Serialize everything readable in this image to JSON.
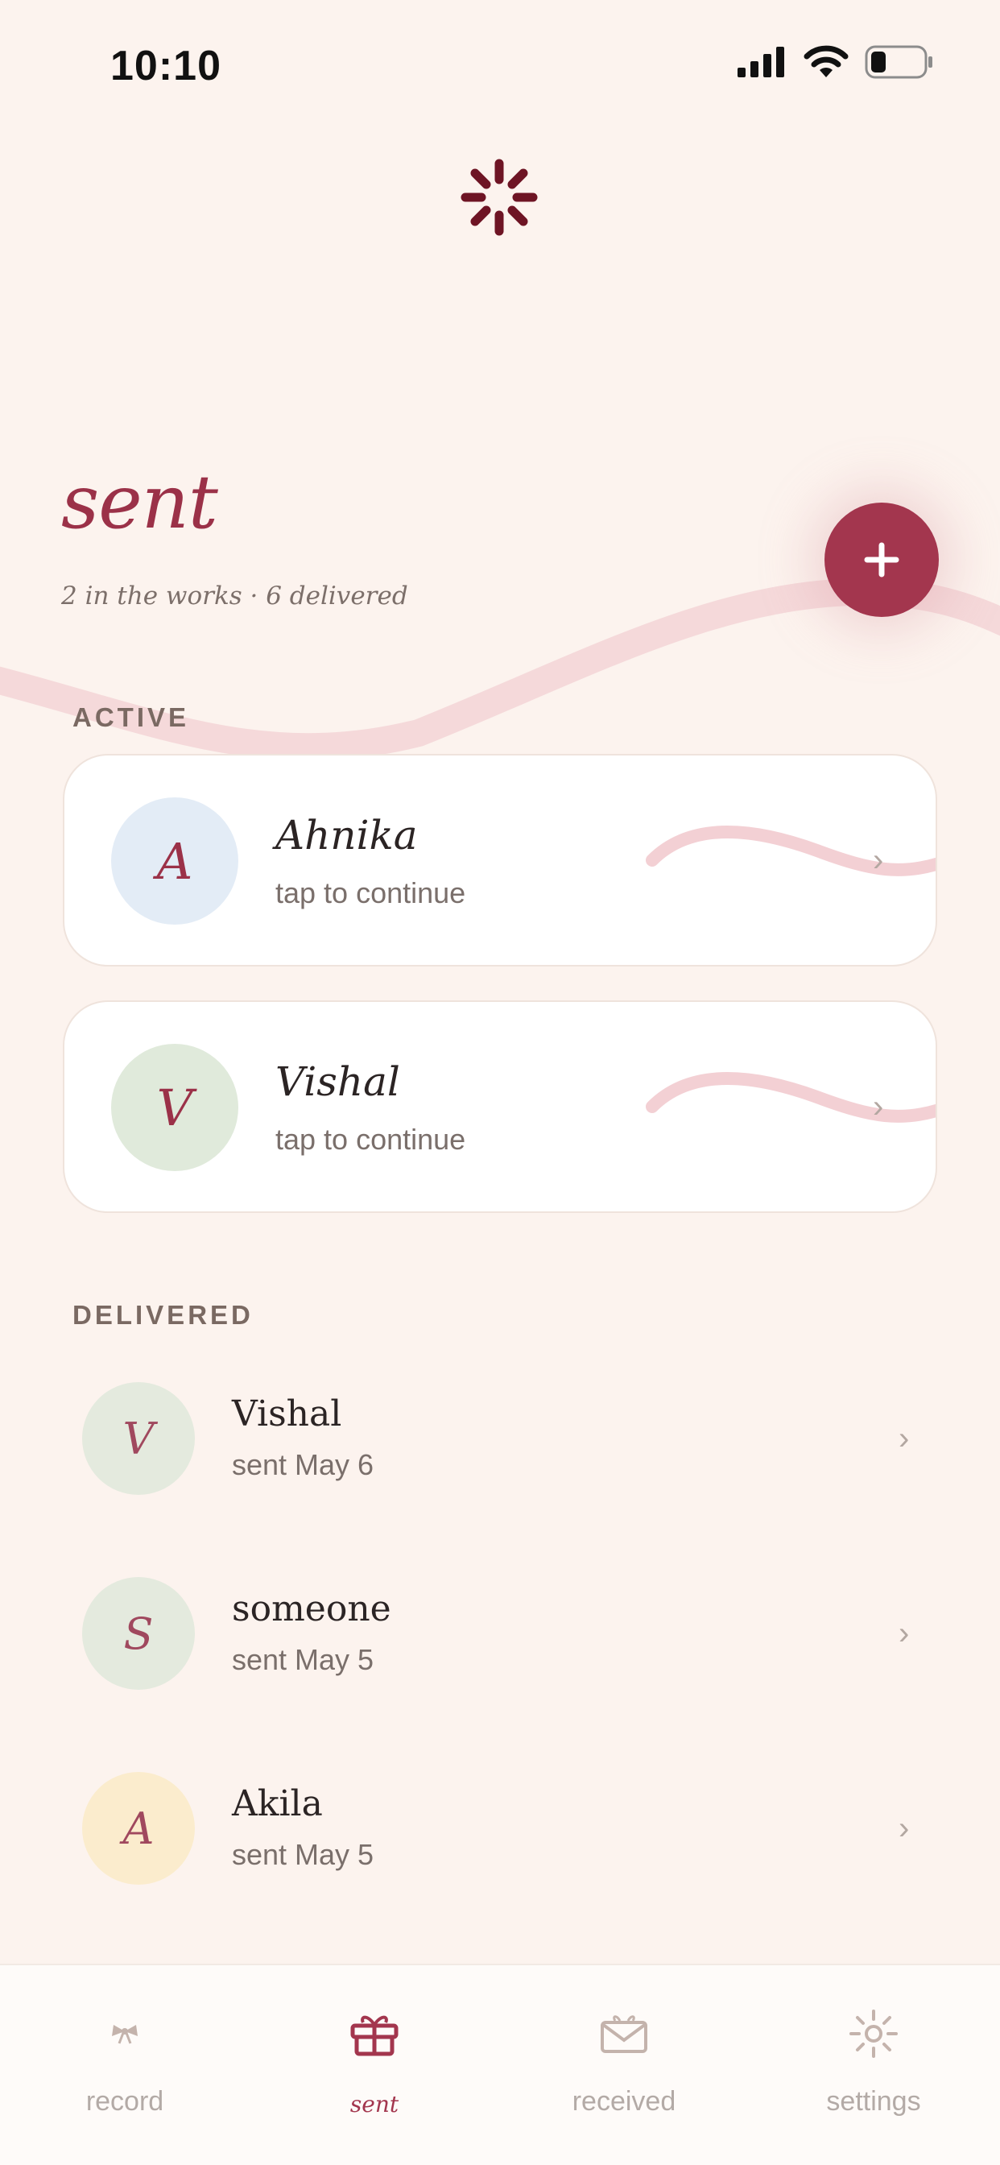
{
  "status": {
    "time": "10:10"
  },
  "header": {
    "title": "sent",
    "subtitle": "2 in the works · 6 delivered",
    "add_button": "+"
  },
  "active": {
    "label": "ACTIVE",
    "items": [
      {
        "initial": "A",
        "name": "Ahnika",
        "hint": "tap to continue",
        "avatar_color": "#e3ecf6"
      },
      {
        "initial": "V",
        "name": "Vishal",
        "hint": "tap to continue",
        "avatar_color": "#e0eadb"
      }
    ]
  },
  "delivered": {
    "label": "DELIVERED",
    "items": [
      {
        "initial": "V",
        "name": "Vishal",
        "date": "sent May 6",
        "avatar_color": "#e4eade"
      },
      {
        "initial": "S",
        "name": "someone",
        "date": "sent May 5",
        "avatar_color": "#e4eade"
      },
      {
        "initial": "A",
        "name": "Akila",
        "date": "sent May 5",
        "avatar_color": "#fbeccd"
      }
    ]
  },
  "tabs": [
    {
      "label": "record",
      "icon": "bow-icon"
    },
    {
      "label": "sent",
      "icon": "gift-icon"
    },
    {
      "label": "received",
      "icon": "mail-icon"
    },
    {
      "label": "settings",
      "icon": "gear-icon"
    }
  ],
  "colors": {
    "accent": "#a3364e",
    "background": "#fcf3ee"
  }
}
